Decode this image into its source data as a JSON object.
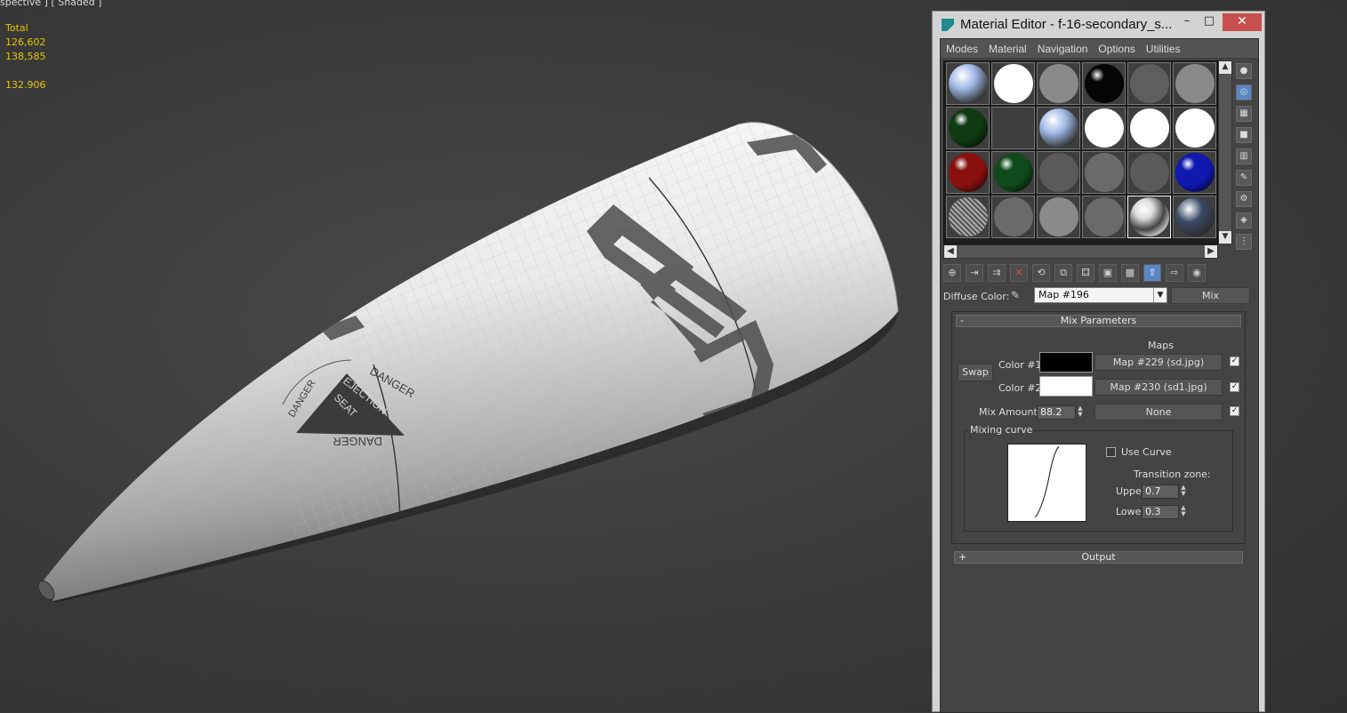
{
  "viewport": {
    "label": "spective ] [ Shaded ]",
    "stats": [
      "Total",
      "126,602",
      "138,585",
      "",
      "132.906"
    ],
    "decal_texts": {
      "danger_top": "DANGER",
      "danger_left": "DANGER",
      "ejection": "EJECTION",
      "seat": "SEAT",
      "danger_bottom": "DANGER"
    }
  },
  "editor": {
    "title": "Material Editor - f-16-secondary_s...",
    "window_buttons": {
      "minimize": "–",
      "maximize": "□",
      "close": "✕"
    },
    "menu": [
      "Modes",
      "Material",
      "Navigation",
      "Options",
      "Utilities"
    ],
    "slots": [
      {
        "color": "#9fb8e6",
        "style": "metal"
      },
      {
        "color": "#ffffff",
        "style": "flat"
      },
      {
        "color": "#8a8a8a",
        "style": "flat"
      },
      {
        "color": "#050505",
        "style": "glossy"
      },
      {
        "color": "#5e5e5e",
        "style": "flat"
      },
      {
        "color": "#8a8a8a",
        "style": "flat"
      },
      {
        "color": "#0f3a12",
        "style": "glossy"
      },
      {
        "color": "",
        "style": "empty"
      },
      {
        "color": "#9fb8e6",
        "style": "metal"
      },
      {
        "color": "#ffffff",
        "style": "flat"
      },
      {
        "color": "#ffffff",
        "style": "flat"
      },
      {
        "color": "#ffffff",
        "style": "flat"
      },
      {
        "color": "#8a1010",
        "style": "glossy"
      },
      {
        "color": "#0f4a1a",
        "style": "glossy"
      },
      {
        "color": "#5a5a5a",
        "style": "flat"
      },
      {
        "color": "#6a6a6a",
        "style": "flat"
      },
      {
        "color": "#5a5a5a",
        "style": "flat"
      },
      {
        "color": "#1018b0",
        "style": "glossy"
      },
      {
        "color": "#8a8a8a",
        "style": "mesh"
      },
      {
        "color": "#6a6a6a",
        "style": "flat"
      },
      {
        "color": "#8a8a8a",
        "style": "flat"
      },
      {
        "color": "#6a6a6a",
        "style": "flat"
      },
      {
        "color": "#c8c8c8",
        "style": "active"
      },
      {
        "color": "#3a4a66",
        "style": "metal"
      }
    ],
    "side_tools": [
      "sample-type-icon",
      "backlight-icon",
      "background-icon",
      "uv-tiling-icon",
      "video-check-icon",
      "make-preview-icon",
      "options-icon",
      "select-by-material-icon",
      "material-map-navigator-icon"
    ],
    "toolbar": [
      "get-material-icon",
      "put-to-scene-icon",
      "assign-to-selection-icon",
      "reset-map-icon",
      "make-unique-icon",
      "put-to-library-icon",
      "material-id-icon",
      "show-map-icon",
      "show-end-result-icon",
      "go-to-parent-icon",
      "go-forward-icon",
      "pick-material-icon"
    ],
    "diffuse_label": "Diffuse Color:",
    "map_name": "Map #196",
    "map_type": "Mix",
    "mix": {
      "rollout_title": "Mix Parameters",
      "rollout_toggle": "-",
      "maps_label": "Maps",
      "swap": "Swap",
      "color1_label": "Color #1",
      "color2_label": "Color #2",
      "color1": "#000000",
      "color2": "#ffffff",
      "map1": "Map #229 (sd.jpg)",
      "map2": "Map #230 (sd1.jpg)",
      "mix_amount_label": "Mix Amount:",
      "mix_amount": "88.2",
      "mix_map": "None",
      "check_mark": "✓",
      "curve_group": "Mixing curve",
      "use_curve": "Use Curve",
      "transition_zone": "Transition zone:",
      "upper_label": "Upper:",
      "upper": "0.7",
      "lower_label": "Lower:",
      "lower": "0.3"
    },
    "output": {
      "title": "Output",
      "toggle": "+"
    }
  }
}
